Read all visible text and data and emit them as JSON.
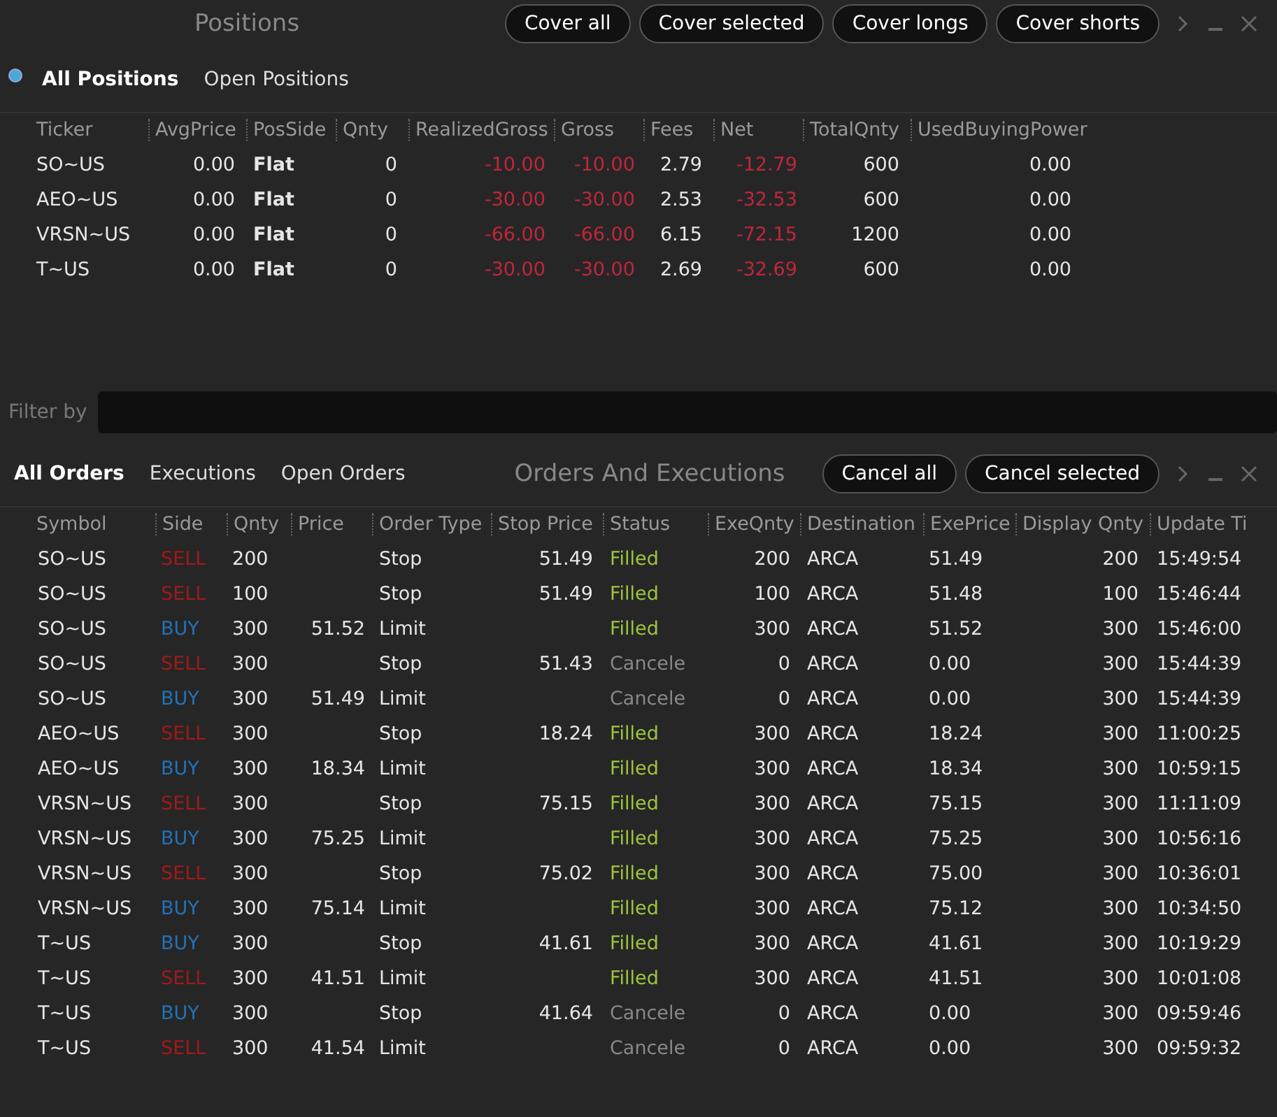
{
  "positions": {
    "title": "Positions",
    "buttons": [
      "Cover all",
      "Cover selected",
      "Cover longs",
      "Cover shorts"
    ],
    "tabs": [
      {
        "label": "All Positions",
        "selected": true
      },
      {
        "label": "Open Positions",
        "selected": false
      }
    ],
    "columns": [
      {
        "label": "Ticker",
        "kind": "text"
      },
      {
        "label": "AvgPrice",
        "kind": "num"
      },
      {
        "label": "PosSide",
        "kind": "side"
      },
      {
        "label": "Qnty",
        "kind": "num"
      },
      {
        "label": "RealizedGross",
        "kind": "loss"
      },
      {
        "label": "Gross",
        "kind": "loss"
      },
      {
        "label": "Fees",
        "kind": "num"
      },
      {
        "label": "Net",
        "kind": "loss"
      },
      {
        "label": "TotalQnty",
        "kind": "num"
      },
      {
        "label": "UsedBuyingPower",
        "kind": "num"
      }
    ],
    "rows": [
      [
        "SO~US",
        "0.00",
        "Flat",
        "0",
        "-10.00",
        "-10.00",
        "2.79",
        "-12.79",
        "600",
        "0.00"
      ],
      [
        "AEO~US",
        "0.00",
        "Flat",
        "0",
        "-30.00",
        "-30.00",
        "2.53",
        "-32.53",
        "600",
        "0.00"
      ],
      [
        "VRSN~US",
        "0.00",
        "Flat",
        "0",
        "-66.00",
        "-66.00",
        "6.15",
        "-72.15",
        "1200",
        "0.00"
      ],
      [
        "T~US",
        "0.00",
        "Flat",
        "0",
        "-30.00",
        "-30.00",
        "2.69",
        "-32.69",
        "600",
        "0.00"
      ]
    ]
  },
  "filter": {
    "label": "Filter by"
  },
  "orders": {
    "title": "Orders And Executions",
    "tabs": [
      {
        "label": "All Orders",
        "selected": true
      },
      {
        "label": "Executions",
        "selected": false
      },
      {
        "label": "Open Orders",
        "selected": false
      }
    ],
    "buttons": [
      "Cancel all",
      "Cancel selected"
    ],
    "columns": [
      "Symbol",
      "Side",
      "Qnty",
      "Price",
      "Order Type",
      "Stop Price",
      "Status",
      "ExeQnty",
      "Destination",
      "ExePrice",
      "Display Qnty",
      "Update Ti"
    ],
    "rows": [
      {
        "symbol": "SO~US",
        "side": {
          "text": "SELL",
          "kind": "sell"
        },
        "qnty": "200",
        "order_type": "Stop",
        "stop_price": "51.49",
        "status": {
          "text": "Filled",
          "kind": "filled"
        },
        "exe_qnty": "200",
        "destination": "ARCA",
        "exe_price": "51.49",
        "display_qnty": "200",
        "update_time": "15:49:54"
      },
      {
        "symbol": "SO~US",
        "side": {
          "text": "SELL",
          "kind": "sell"
        },
        "qnty": "100",
        "order_type": "Stop",
        "stop_price": "51.49",
        "status": {
          "text": "Filled",
          "kind": "filled"
        },
        "exe_qnty": "100",
        "destination": "ARCA",
        "exe_price": "51.48",
        "display_qnty": "100",
        "update_time": "15:46:44"
      },
      {
        "symbol": "SO~US",
        "side": {
          "text": "BUY",
          "kind": "buy"
        },
        "qnty": "300",
        "price": "51.52",
        "order_type": "Limit",
        "status": {
          "text": "Filled",
          "kind": "filled"
        },
        "exe_qnty": "300",
        "destination": "ARCA",
        "exe_price": "51.52",
        "display_qnty": "300",
        "update_time": "15:46:00"
      },
      {
        "symbol": "SO~US",
        "side": {
          "text": "SELL",
          "kind": "sell"
        },
        "qnty": "300",
        "order_type": "Stop",
        "stop_price": "51.43",
        "status": {
          "text": "Cancele",
          "kind": "canceled"
        },
        "exe_qnty": "0",
        "destination": "ARCA",
        "exe_price": "0.00",
        "display_qnty": "300",
        "update_time": "15:44:39"
      },
      {
        "symbol": "SO~US",
        "side": {
          "text": "BUY",
          "kind": "buy"
        },
        "qnty": "300",
        "price": "51.49",
        "order_type": "Limit",
        "status": {
          "text": "Cancele",
          "kind": "canceled"
        },
        "exe_qnty": "0",
        "destination": "ARCA",
        "exe_price": "0.00",
        "display_qnty": "300",
        "update_time": "15:44:39"
      },
      {
        "symbol": "AEO~US",
        "side": {
          "text": "SELL",
          "kind": "sell"
        },
        "qnty": "300",
        "order_type": "Stop",
        "stop_price": "18.24",
        "status": {
          "text": "Filled",
          "kind": "filled"
        },
        "exe_qnty": "300",
        "destination": "ARCA",
        "exe_price": "18.24",
        "display_qnty": "300",
        "update_time": "11:00:25"
      },
      {
        "symbol": "AEO~US",
        "side": {
          "text": "BUY",
          "kind": "buy"
        },
        "qnty": "300",
        "price": "18.34",
        "order_type": "Limit",
        "status": {
          "text": "Filled",
          "kind": "filled"
        },
        "exe_qnty": "300",
        "destination": "ARCA",
        "exe_price": "18.34",
        "display_qnty": "300",
        "update_time": "10:59:15"
      },
      {
        "symbol": "VRSN~US",
        "side": {
          "text": "SELL",
          "kind": "sell"
        },
        "qnty": "300",
        "order_type": "Stop",
        "stop_price": "75.15",
        "status": {
          "text": "Filled",
          "kind": "filled"
        },
        "exe_qnty": "300",
        "destination": "ARCA",
        "exe_price": "75.15",
        "display_qnty": "300",
        "update_time": "11:11:09"
      },
      {
        "symbol": "VRSN~US",
        "side": {
          "text": "BUY",
          "kind": "buy"
        },
        "qnty": "300",
        "price": "75.25",
        "order_type": "Limit",
        "status": {
          "text": "Filled",
          "kind": "filled"
        },
        "exe_qnty": "300",
        "destination": "ARCA",
        "exe_price": "75.25",
        "display_qnty": "300",
        "update_time": "10:56:16"
      },
      {
        "symbol": "VRSN~US",
        "side": {
          "text": "SELL",
          "kind": "sell"
        },
        "qnty": "300",
        "order_type": "Stop",
        "stop_price": "75.02",
        "status": {
          "text": "Filled",
          "kind": "filled"
        },
        "exe_qnty": "300",
        "destination": "ARCA",
        "exe_price": "75.00",
        "display_qnty": "300",
        "update_time": "10:36:01"
      },
      {
        "symbol": "VRSN~US",
        "side": {
          "text": "BUY",
          "kind": "buy"
        },
        "qnty": "300",
        "price": "75.14",
        "order_type": "Limit",
        "status": {
          "text": "Filled",
          "kind": "filled"
        },
        "exe_qnty": "300",
        "destination": "ARCA",
        "exe_price": "75.12",
        "display_qnty": "300",
        "update_time": "10:34:50"
      },
      {
        "symbol": "T~US",
        "side": {
          "text": "BUY",
          "kind": "buy"
        },
        "qnty": "300",
        "order_type": "Stop",
        "stop_price": "41.61",
        "status": {
          "text": "Filled",
          "kind": "filled"
        },
        "exe_qnty": "300",
        "destination": "ARCA",
        "exe_price": "41.61",
        "display_qnty": "300",
        "update_time": "10:19:29"
      },
      {
        "symbol": "T~US",
        "side": {
          "text": "SELL",
          "kind": "sell"
        },
        "qnty": "300",
        "price": "41.51",
        "order_type": "Limit",
        "status": {
          "text": "Filled",
          "kind": "filled"
        },
        "exe_qnty": "300",
        "destination": "ARCA",
        "exe_price": "41.51",
        "display_qnty": "300",
        "update_time": "10:01:08"
      },
      {
        "symbol": "T~US",
        "side": {
          "text": "BUY",
          "kind": "buy"
        },
        "qnty": "300",
        "order_type": "Stop",
        "stop_price": "41.64",
        "status": {
          "text": "Cancele",
          "kind": "canceled"
        },
        "exe_qnty": "0",
        "destination": "ARCA",
        "exe_price": "0.00",
        "display_qnty": "300",
        "update_time": "09:59:46"
      },
      {
        "symbol": "T~US",
        "side": {
          "text": "SELL",
          "kind": "sell"
        },
        "qnty": "300",
        "price": "41.54",
        "order_type": "Limit",
        "status": {
          "text": "Cancele",
          "kind": "canceled"
        },
        "exe_qnty": "0",
        "destination": "ARCA",
        "exe_price": "0.00",
        "display_qnty": "300",
        "update_time": "09:59:32"
      }
    ]
  }
}
